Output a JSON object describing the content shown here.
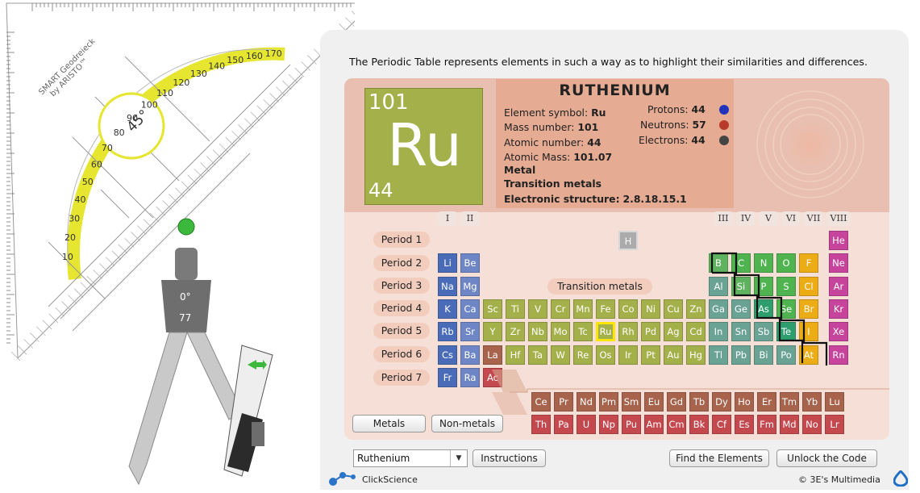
{
  "description": "The Periodic Table represents elements in such a way as to highlight their similarities and differences.",
  "tools": {
    "protractor": {
      "brand_line1": "SMART Geodreieck",
      "brand_line2": "by ARISTO™",
      "angle": "45°",
      "scale_labels": [
        "10",
        "20",
        "30",
        "40",
        "50",
        "60",
        "70",
        "80",
        "90",
        "100",
        "110",
        "120",
        "130",
        "140",
        "150",
        "160",
        "170"
      ]
    },
    "compass": {
      "angle": "0°",
      "radius": "77"
    }
  },
  "selected_element": {
    "name": "RUTHENIUM",
    "tile_mass": "101",
    "tile_symbol": "Ru",
    "tile_atomic": "44",
    "symbol_label": "Element symbol:",
    "symbol_value": "Ru",
    "mass_label": "Mass number:",
    "mass_value": "101",
    "atomic_label": "Atomic number:",
    "atomic_value": "44",
    "atomic_mass_label": "Atomic Mass:",
    "atomic_mass_value": "101.07",
    "category": "Metal",
    "group_name": "Transition metals",
    "structure_label": "Electronic structure:",
    "structure_value": "2.8.18.15.1",
    "protons_label": "Protons:",
    "protons_value": "44",
    "neutrons_label": "Neutrons:",
    "neutrons_value": "57",
    "electrons_label": "Electrons:",
    "electrons_value": "44"
  },
  "colors": {
    "alkali": "#4a6cb8",
    "alkaline": "#6e86c6",
    "transition": "#a4b04a",
    "boron": "#5fb25f",
    "poor": "#6aa393",
    "metalloid": "#2f9e6f",
    "nonmetal": "#4fb34f",
    "halogen": "#ebac16",
    "noble": "#c6449c",
    "lanthanide": "#a8634d",
    "actinide": "#c4494f",
    "hydrogen": "#ababab",
    "proton": "#2233bb",
    "neutron": "#b83a2a",
    "electron": "#444444"
  },
  "group_labels_left": [
    "I",
    "II"
  ],
  "group_labels_right": [
    "III",
    "IV",
    "V",
    "VI",
    "VII",
    "VIII"
  ],
  "periods": [
    "Period 1",
    "Period 2",
    "Period 3",
    "Period 4",
    "Period 5",
    "Period 6",
    "Period 7"
  ],
  "transition_label": "Transition metals",
  "elements": [
    {
      "s": "H",
      "row": 0,
      "col": 8,
      "t": "hydrogen"
    },
    {
      "s": "He",
      "row": 0,
      "col": 17,
      "t": "noble"
    },
    {
      "s": "Li",
      "row": 1,
      "col": 0,
      "t": "alkali"
    },
    {
      "s": "Be",
      "row": 1,
      "col": 1,
      "t": "alkaline"
    },
    {
      "s": "B",
      "row": 1,
      "col": 12,
      "t": "boron"
    },
    {
      "s": "C",
      "row": 1,
      "col": 13,
      "t": "nonmetal"
    },
    {
      "s": "N",
      "row": 1,
      "col": 14,
      "t": "nonmetal"
    },
    {
      "s": "O",
      "row": 1,
      "col": 15,
      "t": "nonmetal"
    },
    {
      "s": "F",
      "row": 1,
      "col": 16,
      "t": "halogen"
    },
    {
      "s": "Ne",
      "row": 1,
      "col": 17,
      "t": "noble"
    },
    {
      "s": "Na",
      "row": 2,
      "col": 0,
      "t": "alkali"
    },
    {
      "s": "Mg",
      "row": 2,
      "col": 1,
      "t": "alkaline"
    },
    {
      "s": "Al",
      "row": 2,
      "col": 12,
      "t": "poor"
    },
    {
      "s": "Si",
      "row": 2,
      "col": 13,
      "t": "boron"
    },
    {
      "s": "P",
      "row": 2,
      "col": 14,
      "t": "nonmetal"
    },
    {
      "s": "S",
      "row": 2,
      "col": 15,
      "t": "nonmetal"
    },
    {
      "s": "Cl",
      "row": 2,
      "col": 16,
      "t": "halogen"
    },
    {
      "s": "Ar",
      "row": 2,
      "col": 17,
      "t": "noble"
    },
    {
      "s": "K",
      "row": 3,
      "col": 0,
      "t": "alkali"
    },
    {
      "s": "Ca",
      "row": 3,
      "col": 1,
      "t": "alkaline"
    },
    {
      "s": "Sc",
      "row": 3,
      "col": 2,
      "t": "transition"
    },
    {
      "s": "Ti",
      "row": 3,
      "col": 3,
      "t": "transition"
    },
    {
      "s": "V",
      "row": 3,
      "col": 4,
      "t": "transition"
    },
    {
      "s": "Cr",
      "row": 3,
      "col": 5,
      "t": "transition"
    },
    {
      "s": "Mn",
      "row": 3,
      "col": 6,
      "t": "transition"
    },
    {
      "s": "Fe",
      "row": 3,
      "col": 7,
      "t": "transition"
    },
    {
      "s": "Co",
      "row": 3,
      "col": 8,
      "t": "transition"
    },
    {
      "s": "Ni",
      "row": 3,
      "col": 9,
      "t": "transition"
    },
    {
      "s": "Cu",
      "row": 3,
      "col": 10,
      "t": "transition"
    },
    {
      "s": "Zn",
      "row": 3,
      "col": 11,
      "t": "transition"
    },
    {
      "s": "Ga",
      "row": 3,
      "col": 12,
      "t": "poor"
    },
    {
      "s": "Ge",
      "row": 3,
      "col": 13,
      "t": "poor"
    },
    {
      "s": "As",
      "row": 3,
      "col": 14,
      "t": "metalloid"
    },
    {
      "s": "Se",
      "row": 3,
      "col": 15,
      "t": "nonmetal"
    },
    {
      "s": "Br",
      "row": 3,
      "col": 16,
      "t": "halogen"
    },
    {
      "s": "Kr",
      "row": 3,
      "col": 17,
      "t": "noble"
    },
    {
      "s": "Rb",
      "row": 4,
      "col": 0,
      "t": "alkali"
    },
    {
      "s": "Sr",
      "row": 4,
      "col": 1,
      "t": "alkaline"
    },
    {
      "s": "Y",
      "row": 4,
      "col": 2,
      "t": "transition"
    },
    {
      "s": "Zr",
      "row": 4,
      "col": 3,
      "t": "transition"
    },
    {
      "s": "Nb",
      "row": 4,
      "col": 4,
      "t": "transition"
    },
    {
      "s": "Mo",
      "row": 4,
      "col": 5,
      "t": "transition"
    },
    {
      "s": "Tc",
      "row": 4,
      "col": 6,
      "t": "transition"
    },
    {
      "s": "Ru",
      "row": 4,
      "col": 7,
      "t": "transition",
      "sel": true
    },
    {
      "s": "Rh",
      "row": 4,
      "col": 8,
      "t": "transition"
    },
    {
      "s": "Pd",
      "row": 4,
      "col": 9,
      "t": "transition"
    },
    {
      "s": "Ag",
      "row": 4,
      "col": 10,
      "t": "transition"
    },
    {
      "s": "Cd",
      "row": 4,
      "col": 11,
      "t": "transition"
    },
    {
      "s": "In",
      "row": 4,
      "col": 12,
      "t": "poor"
    },
    {
      "s": "Sn",
      "row": 4,
      "col": 13,
      "t": "poor"
    },
    {
      "s": "Sb",
      "row": 4,
      "col": 14,
      "t": "poor"
    },
    {
      "s": "Te",
      "row": 4,
      "col": 15,
      "t": "metalloid"
    },
    {
      "s": "I",
      "row": 4,
      "col": 16,
      "t": "halogen"
    },
    {
      "s": "Xe",
      "row": 4,
      "col": 17,
      "t": "noble"
    },
    {
      "s": "Cs",
      "row": 5,
      "col": 0,
      "t": "alkali"
    },
    {
      "s": "Ba",
      "row": 5,
      "col": 1,
      "t": "alkaline"
    },
    {
      "s": "La",
      "row": 5,
      "col": 2,
      "t": "lanthanide"
    },
    {
      "s": "Hf",
      "row": 5,
      "col": 3,
      "t": "transition"
    },
    {
      "s": "Ta",
      "row": 5,
      "col": 4,
      "t": "transition"
    },
    {
      "s": "W",
      "row": 5,
      "col": 5,
      "t": "transition"
    },
    {
      "s": "Re",
      "row": 5,
      "col": 6,
      "t": "transition"
    },
    {
      "s": "Os",
      "row": 5,
      "col": 7,
      "t": "transition"
    },
    {
      "s": "Ir",
      "row": 5,
      "col": 8,
      "t": "transition"
    },
    {
      "s": "Pt",
      "row": 5,
      "col": 9,
      "t": "transition"
    },
    {
      "s": "Au",
      "row": 5,
      "col": 10,
      "t": "transition"
    },
    {
      "s": "Hg",
      "row": 5,
      "col": 11,
      "t": "transition"
    },
    {
      "s": "Tl",
      "row": 5,
      "col": 12,
      "t": "poor"
    },
    {
      "s": "Pb",
      "row": 5,
      "col": 13,
      "t": "poor"
    },
    {
      "s": "Bi",
      "row": 5,
      "col": 14,
      "t": "poor"
    },
    {
      "s": "Po",
      "row": 5,
      "col": 15,
      "t": "poor"
    },
    {
      "s": "At",
      "row": 5,
      "col": 16,
      "t": "halogen"
    },
    {
      "s": "Rn",
      "row": 5,
      "col": 17,
      "t": "noble"
    },
    {
      "s": "Fr",
      "row": 6,
      "col": 0,
      "t": "alkali"
    },
    {
      "s": "Ra",
      "row": 6,
      "col": 1,
      "t": "alkaline"
    },
    {
      "s": "Ac",
      "row": 6,
      "col": 2,
      "t": "actinide"
    }
  ],
  "lanthanides": [
    "Ce",
    "Pr",
    "Nd",
    "Pm",
    "Sm",
    "Eu",
    "Gd",
    "Tb",
    "Dy",
    "Ho",
    "Er",
    "Tm",
    "Yb",
    "Lu"
  ],
  "actinides": [
    "Th",
    "Pa",
    "U",
    "Np",
    "Pu",
    "Am",
    "Cm",
    "Bk",
    "Cf",
    "Es",
    "Fm",
    "Md",
    "No",
    "Lr"
  ],
  "buttons": {
    "metals": "Metals",
    "nonmetals": "Non-metals",
    "instructions": "Instructions",
    "find": "Find the Elements",
    "unlock": "Unlock the Code"
  },
  "dropdown": {
    "value": "Ruthenium"
  },
  "footer": {
    "left": "ClickScience",
    "right": "© 3E's Multimedia"
  }
}
